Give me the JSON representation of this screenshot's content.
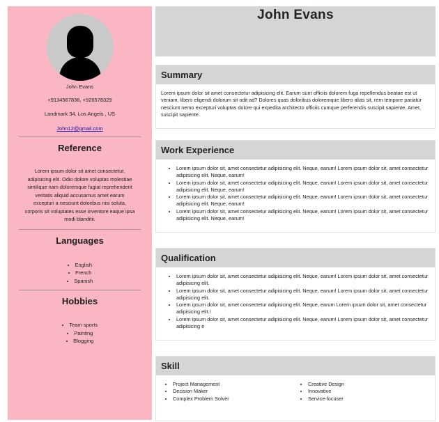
{
  "sidebar": {
    "name": "John Evans",
    "phone": "+9134567836, +926578329",
    "address": "Landmark 34, Los Angels , US",
    "email": "John12@gmail.com",
    "reference": {
      "title": "Reference",
      "text": "Lorem ipsum dolor sit amet consectetur, adipisicing elit. Odio dolore voluptas molestiae similique nam doloremque fugiat reprehenderit veritatis aliquid accusamus amet earum excepturi a nesciunt doloribus nisi soluta, corporis sit voluptates esse inventore eaque ipsa modi blanditii."
    },
    "languages": {
      "title": "Languages",
      "items": [
        "English",
        "French",
        "Spanish"
      ]
    },
    "hobbies": {
      "title": "Hobbies",
      "items": [
        "Team sports",
        "Painting",
        "Blogging"
      ]
    }
  },
  "main": {
    "name": "John Evans",
    "summary": {
      "title": "Summary",
      "text": "Lorem ipsum dolor sit amet consectetur adipisicing elit. Earum sunt officiis dolorem fuga repellendus beatae est ut veniam, libero eligendi dolorum sit odit ad? Dolores quas doloribus doloremque libero alias sit, rem tempore pariatur nesciunt nemo excepturi voluptas dolore qui expedita architecto officiis cumque perferendis suscipit sapiente. Amet, suscipit sapiente."
    },
    "work": {
      "title": "Work Experience",
      "items": [
        "Lorem ipsum dolor sit, amet consectetur adipisicing elit. Neque, earum! Lorem ipsum dolor sit, amet consectetur adipisicing elit. Neque, earum!",
        "Lorem ipsum dolor sit, amet consectetur adipisicing elit. Neque, earum! Lorem ipsum dolor sit, amet consectetur adipisicing elit. Neque, earum!",
        "Lorem ipsum dolor sit, amet consectetur adipisicing elit. Neque, earum! Lorem ipsum dolor sit, amet consectetur adipisicing elit. Neque, earum!",
        "Lorem ipsum dolor sit, amet consectetur adipisicing elit. Neque, earum! Lorem ipsum dolor sit, amet consectetur adipisicing elit. Neque, earum!"
      ]
    },
    "qualification": {
      "title": "Qualification",
      "items": [
        "Lorem ipsum dolor sit, amet consectetur adipisicing elit. Neque, earum! Lorem ipsum dolor sit, amet consectetur adipisicing elit.",
        "Lorem ipsum dolor sit, amet consectetur adipisicing elit. Neque, earum! Lorem ipsum dolor sit, amet consectetur adipisicing elit.",
        "Lorem ipsum dolor sit, amet consectetur adipisicing elit. Neque, earum Lorem ipsum dolor sit, amet consectetur adipisicing elit.!",
        "Lorem ipsum dolor sit, amet consectetur adipisicing elit. Neque, earum! Lorem ipsum dolor sit, amet consectetur adipisicing e"
      ]
    },
    "skill": {
      "title": "Skill",
      "left": [
        "Project Management",
        "Decision Maker",
        "Complex Problem Solver"
      ],
      "right": [
        "Creative Design",
        "Innovative",
        "Service-focuser"
      ]
    }
  },
  "colors": {
    "sidebar_bg": "#fbb6c4",
    "header_bg": "#d6d4d7",
    "link": "#1a0dab"
  }
}
